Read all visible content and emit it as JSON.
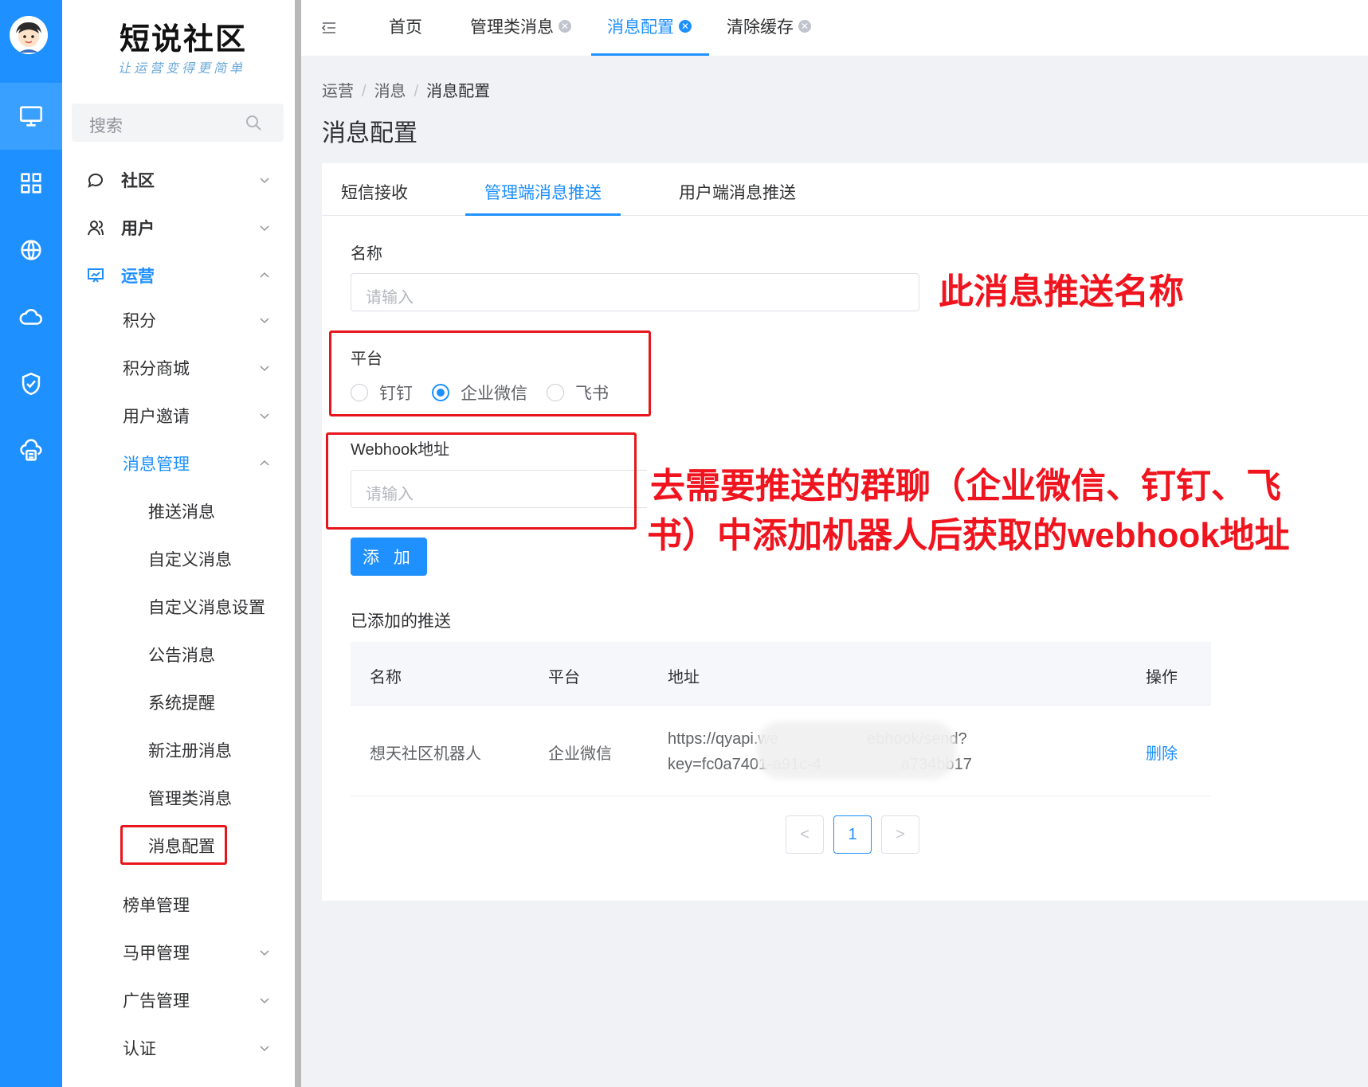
{
  "sidebar": {
    "logo_title": "短说社区",
    "logo_subtitle": "让运营变得更简单",
    "search_placeholder": "搜索",
    "menu": [
      {
        "label": "社区",
        "icon": "chat-icon"
      },
      {
        "label": "用户",
        "icon": "user-icon"
      },
      {
        "label": "运营",
        "icon": "presentation-icon"
      },
      {
        "label": "积分"
      },
      {
        "label": "积分商城"
      },
      {
        "label": "用户邀请"
      },
      {
        "label": "消息管理"
      },
      {
        "label": "推送消息"
      },
      {
        "label": "自定义消息"
      },
      {
        "label": "自定义消息设置"
      },
      {
        "label": "公告消息"
      },
      {
        "label": "系统提醒"
      },
      {
        "label": "新注册消息"
      },
      {
        "label": "管理类消息"
      },
      {
        "label": "消息配置"
      },
      {
        "label": "榜单管理"
      },
      {
        "label": "马甲管理"
      },
      {
        "label": "广告管理"
      },
      {
        "label": "认证"
      }
    ]
  },
  "rail": [
    "monitor-icon",
    "grid-icon",
    "globe-icon",
    "cloud-icon",
    "shield-check-icon",
    "cloud-server-icon"
  ],
  "header": {
    "tabs": [
      {
        "label": "首页"
      },
      {
        "label": "管理类消息"
      },
      {
        "label": "消息配置",
        "active": true
      },
      {
        "label": "清除缓存"
      }
    ]
  },
  "breadcrumb": [
    "运营",
    "消息",
    "消息配置"
  ],
  "page_title": "消息配置",
  "card_tabs": [
    "短信接收",
    "管理端消息推送",
    "用户端消息推送"
  ],
  "form": {
    "name_label": "名称",
    "name_placeholder": "请输入",
    "platform_label": "平台",
    "platform_options": [
      "钉钉",
      "企业微信",
      "飞书"
    ],
    "platform_selected": "企业微信",
    "webhook_label": "Webhook地址",
    "webhook_placeholder": "请输入",
    "add_button": "添 加"
  },
  "annotations": {
    "name_note": "此消息推送名称",
    "webhook_note_line1": "去需要推送的群聊（企业微信、钉钉、飞",
    "webhook_note_line2": "书）中添加机器人后获取的webhook地址"
  },
  "table": {
    "title": "已添加的推送",
    "headers": [
      "名称",
      "平台",
      "地址",
      "操作"
    ],
    "rows": [
      {
        "name": "想天社区机器人",
        "platform": "企业微信",
        "url_line1": "https://qyapi.we                    ebhook/send?",
        "url_line2": "key=fc0a7401-a91c-4                  a734bb17",
        "action": "删除"
      }
    ]
  },
  "pagination": {
    "prev": "<",
    "current": "1",
    "next": ">"
  },
  "colors": {
    "accent": "#1e90ff",
    "annotation": "#f0141e",
    "rail": "#1e90ff"
  }
}
